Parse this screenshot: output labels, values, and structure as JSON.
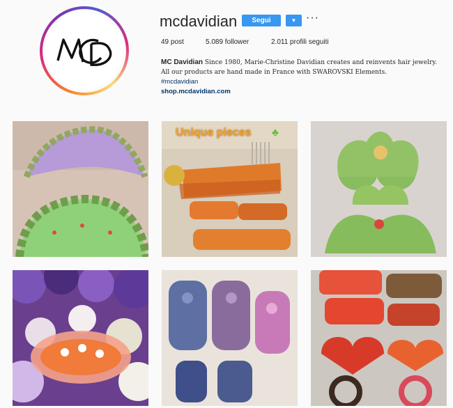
{
  "profile": {
    "username": "mcdavidian",
    "follow_label": "Segui",
    "dropdown_icon": "chevron-down-icon",
    "more_label": "···",
    "logo_text": "MCD"
  },
  "stats": {
    "posts": "49 post",
    "followers": "5.089 follower",
    "following": "2.011 profili seguiti"
  },
  "bio": {
    "name": "MC Davidian",
    "text": "Since 1980, Marie-Christine Davidian creates and reinvents hair jewelry. All our products are hand made in France with SWAROVSKI Elements.",
    "hashtag": "#mcdavidian",
    "link": "shop.mcdavidian.com"
  },
  "posts": [
    {
      "alt": "lilac and green crystal hair clip"
    },
    {
      "alt": "orange crystal combs and barrettes",
      "overlay": "Unique pieces"
    },
    {
      "alt": "green claw clips with crystals"
    },
    {
      "alt": "orange crystal clip on flowers"
    },
    {
      "alt": "colored crystal claw clips"
    },
    {
      "alt": "red and gold heart barrettes"
    }
  ],
  "colors": {
    "accent": "#3897f0",
    "link": "#003569"
  }
}
